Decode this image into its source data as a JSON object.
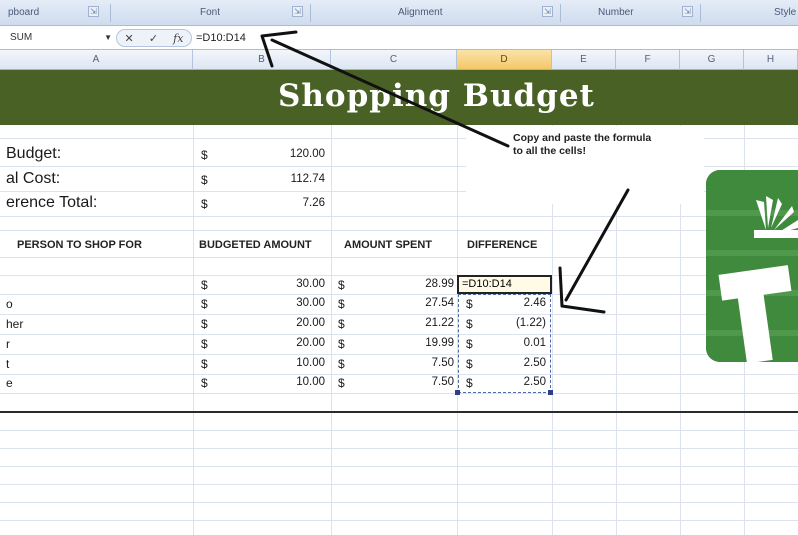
{
  "ribbon": {
    "groups": [
      {
        "label": "pboard"
      },
      {
        "label": "Font"
      },
      {
        "label": "Alignment"
      },
      {
        "label": "Number"
      },
      {
        "label": "Style"
      }
    ]
  },
  "formula_bar": {
    "name_box": "SUM",
    "cancel_glyph": "✕",
    "enter_glyph": "✓",
    "fx_glyph": "fx",
    "formula": "=D10:D14"
  },
  "columns": [
    "A",
    "B",
    "C",
    "D",
    "E",
    "F",
    "G",
    "H"
  ],
  "active_column": "D",
  "sheet": {
    "title": "Shopping Budget",
    "summary": [
      {
        "label": "Budget:",
        "currency": "$",
        "value": "120.00"
      },
      {
        "label": "al Cost:",
        "currency": "$",
        "value": "112.74"
      },
      {
        "label": "erence Total:",
        "currency": "$",
        "value": "7.26"
      }
    ],
    "headers": {
      "person": "PERSON TO SHOP FOR",
      "budgeted": "BUDGETED AMOUNT",
      "spent": "AMOUNT SPENT",
      "difference": "DIFFERENCE"
    },
    "rows": [
      {
        "name": "",
        "budgeted": "30.00",
        "spent": "28.99",
        "difference": "=D10:D14"
      },
      {
        "name": "o",
        "budgeted": "30.00",
        "spent": "27.54",
        "difference": "2.46"
      },
      {
        "name": "her",
        "budgeted": "20.00",
        "spent": "21.22",
        "difference": "(1.22)"
      },
      {
        "name": "r",
        "budgeted": "20.00",
        "spent": "19.99",
        "difference": "0.01"
      },
      {
        "name": "t",
        "budgeted": "10.00",
        "spent": "7.50",
        "difference": "2.50"
      },
      {
        "name": "e",
        "budgeted": "10.00",
        "spent": "7.50",
        "difference": "2.50"
      }
    ],
    "currency_symbol": "$"
  },
  "callout": {
    "line1": "Copy and paste the formula",
    "line2": "to all the cells!"
  },
  "colors": {
    "banner": "#4a6125",
    "logo": "#3a7a3a",
    "active_header": "#f4c86a"
  }
}
